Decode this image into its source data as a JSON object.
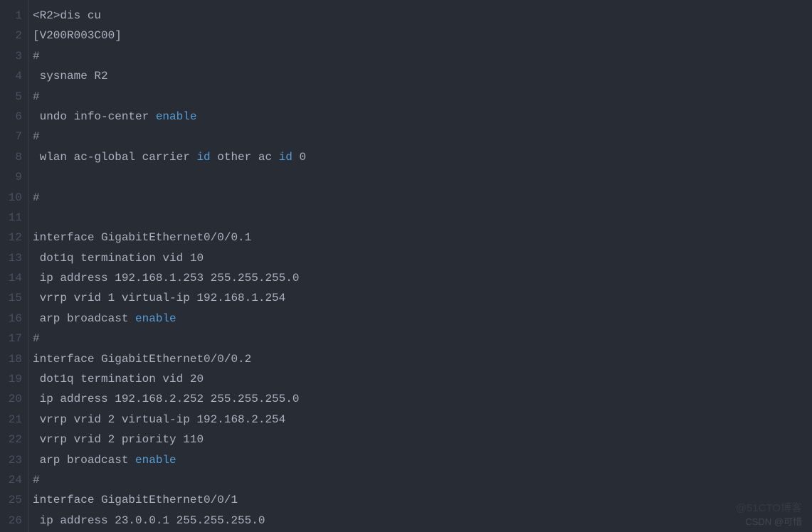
{
  "watermark_primary": "CSDN @可惜",
  "watermark_secondary": "@51CTO博客",
  "code_lines": [
    [
      {
        "t": "<",
        "c": "plain"
      },
      {
        "t": "R2",
        "c": "plain"
      },
      {
        "t": ">",
        "c": "plain"
      },
      {
        "t": "dis cu",
        "c": "plain"
      }
    ],
    [
      {
        "t": "[V200R003C00]",
        "c": "plain"
      }
    ],
    [
      {
        "t": "#",
        "c": "dim"
      }
    ],
    [
      {
        "t": " sysname R2",
        "c": "plain"
      }
    ],
    [
      {
        "t": "#",
        "c": "dim"
      }
    ],
    [
      {
        "t": " undo info-center ",
        "c": "plain"
      },
      {
        "t": "enable",
        "c": "keyword"
      }
    ],
    [
      {
        "t": "#",
        "c": "dim"
      }
    ],
    [
      {
        "t": " wlan ac-global carrier ",
        "c": "plain"
      },
      {
        "t": "id",
        "c": "keyword"
      },
      {
        "t": " other ac ",
        "c": "plain"
      },
      {
        "t": "id",
        "c": "keyword"
      },
      {
        "t": " 0",
        "c": "plain"
      }
    ],
    [
      {
        "t": " ",
        "c": "plain"
      }
    ],
    [
      {
        "t": "#",
        "c": "dim"
      }
    ],
    [
      {
        "t": " ",
        "c": "plain"
      }
    ],
    [
      {
        "t": "interface GigabitEthernet0/0/0.1",
        "c": "plain"
      }
    ],
    [
      {
        "t": " dot1q termination vid 10",
        "c": "plain"
      }
    ],
    [
      {
        "t": " ip address 192.168.1.253 255.255.255.0",
        "c": "plain"
      }
    ],
    [
      {
        "t": " vrrp vrid 1 virtual-ip 192.168.1.254",
        "c": "plain"
      }
    ],
    [
      {
        "t": " arp broadcast ",
        "c": "plain"
      },
      {
        "t": "enable",
        "c": "keyword"
      }
    ],
    [
      {
        "t": "#",
        "c": "dim"
      }
    ],
    [
      {
        "t": "interface GigabitEthernet0/0/0.2",
        "c": "plain"
      }
    ],
    [
      {
        "t": " dot1q termination vid 20",
        "c": "plain"
      }
    ],
    [
      {
        "t": " ip address 192.168.2.252 255.255.255.0",
        "c": "plain"
      }
    ],
    [
      {
        "t": " vrrp vrid 2 virtual-ip 192.168.2.254",
        "c": "plain"
      }
    ],
    [
      {
        "t": " vrrp vrid 2 priority 110",
        "c": "plain"
      }
    ],
    [
      {
        "t": " arp broadcast ",
        "c": "plain"
      },
      {
        "t": "enable",
        "c": "keyword"
      }
    ],
    [
      {
        "t": "#",
        "c": "dim"
      }
    ],
    [
      {
        "t": "interface GigabitEthernet0/0/1",
        "c": "plain"
      }
    ],
    [
      {
        "t": " ip address 23.0.0.1 255.255.255.0",
        "c": "plain"
      }
    ]
  ]
}
